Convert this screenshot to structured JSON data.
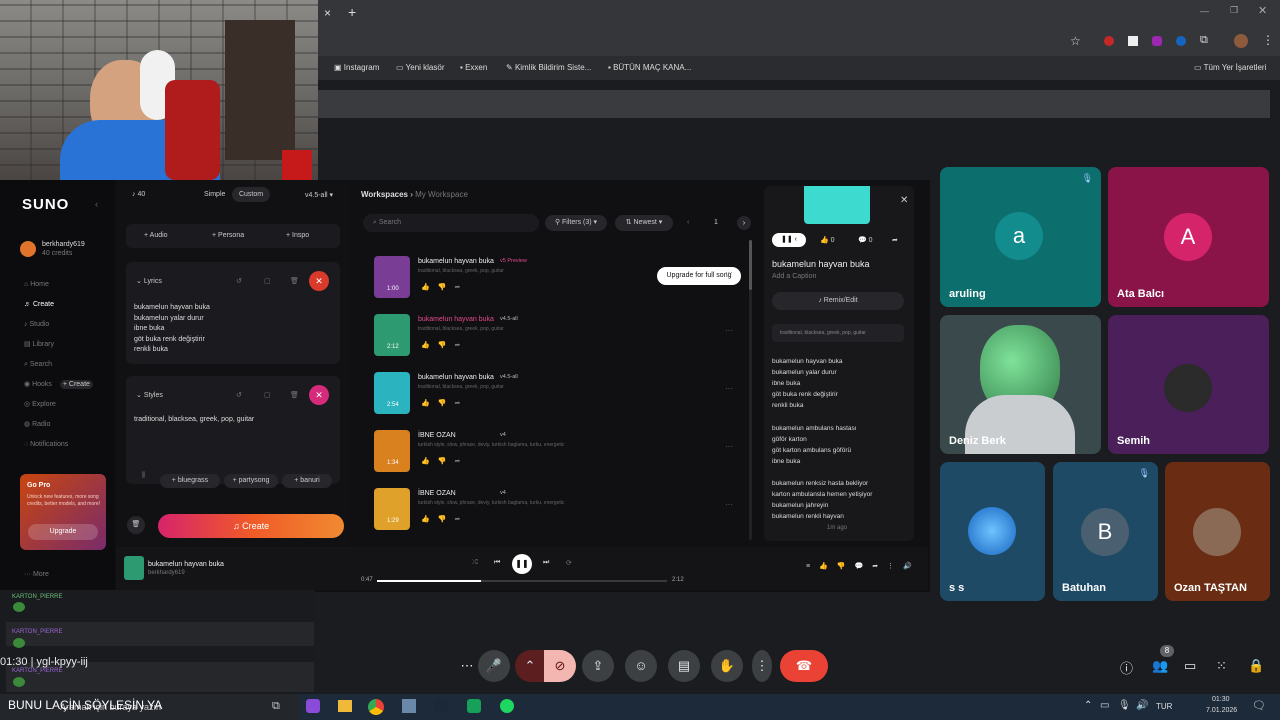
{
  "browser": {
    "new_tab": "+",
    "close": "×",
    "bookmarks": [
      "Instagram",
      "Yeni klasör",
      "Exxen",
      "Kimlik Bildirim Siste...",
      "BÜTÜN MAÇ KANA...",
      "Tüm Yer İşaretleri"
    ]
  },
  "suno": {
    "logo": "SUNO",
    "user": "berkhardy619",
    "credits": "40 credits",
    "nav": [
      "Home",
      "Create",
      "Studio",
      "Library",
      "Search",
      "Hooks",
      "Explore",
      "Radio",
      "Notifications"
    ],
    "hooks_create": "+ Create",
    "gopro": {
      "title": "Go Pro",
      "text": "Unlock new features, more song credits, better models, and more!",
      "button": "Upgrade"
    },
    "more": "More",
    "top": {
      "count": "40",
      "simple": "Simple",
      "custom": "Custom",
      "version": "v4.5-all"
    },
    "adds": [
      "+ Audio",
      "+ Persona",
      "+ Inspo"
    ],
    "lyrics_label": "Lyrics",
    "lyrics": [
      "bukamelun hayvan buka",
      "bukamelun yalar durur",
      "ibne buka",
      "göt buka renk değiştirir",
      "renkli buka"
    ],
    "styles_label": "Styles",
    "styles": "traditional, blacksea, greek, pop, guitar",
    "tags": [
      "+ bluegrass",
      "+ partysong",
      "+ banuri"
    ],
    "create": "Create",
    "breadcrumb": {
      "a": "Workspaces",
      "sep": "›",
      "b": "My Workspace"
    },
    "search_placeholder": "Search",
    "filters": "Filters (3)",
    "sort": "Newest",
    "page": "1",
    "upgrade_tip": "Upgrade for full song",
    "songs": [
      {
        "title": "bukamelun hayvan buka",
        "badge": "v5 Preview",
        "tags": "traditional, blacksea, greek, pop, guitar",
        "time": "1:00",
        "color": "#7a3d96"
      },
      {
        "title": "bukamelun hayvan buka",
        "badge": "v4.5-all",
        "tags": "traditional, blacksea, greek, pop, guitar",
        "time": "2:12",
        "color": "#2e9a72"
      },
      {
        "title": "bukamelun hayvan buka",
        "badge": "v4.5-all",
        "tags": "traditional, blacksea, greek, pop, guitar",
        "time": "2:54",
        "color": "#2bb3c0"
      },
      {
        "title": "İBNE OZAN",
        "badge": "v4",
        "tags": "turkish style, slow, phrase, deviy, turkish baglama, turku, energetic",
        "time": "1:34",
        "color": "#d9801f"
      },
      {
        "title": "İBNE OZAN",
        "badge": "v4",
        "tags": "turkish style, slow, phrase, deviy, turkish baglama, turku, energetic",
        "time": "1:29",
        "color": "#e0a12a"
      }
    ],
    "detail": {
      "likes": "0",
      "comments": "0",
      "title": "bukamelun hayvan buka",
      "caption": "Add a Caption",
      "remix": "Remix/Edit",
      "tags": "traditional, blacksea, greek, pop, guitar",
      "lyrics": [
        "bukamelun hayvan buka",
        "bukamelun yalar durur",
        "ibne buka",
        "göt buka renk değiştirir",
        "renkli buka",
        "",
        "bukamelun ambulans hastası",
        "göför karton",
        "göt karton ambulans göförü",
        "ibne buka",
        "",
        "bukamelun renksiz hasta bekliyor",
        "karton ambulansla hemen yetişiyor",
        "bukamelun jahreyin",
        "bukamelun renkli hayvan"
      ],
      "age": "1m ago"
    },
    "player": {
      "title": "bukamelun hayvan buka",
      "artist": "berkhardy619",
      "current": "0:47",
      "total": "2:12",
      "progress": 0.36
    }
  },
  "participants": [
    {
      "name": "aruling",
      "initial": "a",
      "bg": "#0d6e6e",
      "circle": "#128c8c",
      "muted": true
    },
    {
      "name": "Ata Balcı",
      "initial": "A",
      "bg": "#8a1448",
      "circle": "#d6246b",
      "muted": false
    },
    {
      "name": "Deniz Berk",
      "initial": "",
      "bg": "#3a4a4c",
      "circle": "",
      "muted": false
    },
    {
      "name": "Semih",
      "initial": "",
      "bg": "#4a1f5a",
      "circle": "",
      "muted": false
    },
    {
      "name": "s s",
      "initial": "",
      "bg": "#1e4a66",
      "circle": "",
      "muted": false
    },
    {
      "name": "Batuhan",
      "initial": "B",
      "bg": "#1e4a66",
      "circle": "#4a6070",
      "muted": true
    },
    {
      "name": "Ozan TAŞTAN",
      "initial": "",
      "bg": "#6a2c12",
      "circle": "",
      "muted": false
    }
  ],
  "chat": {
    "user1": "KARTON_PIERRE",
    "user2": "KARTON_PIERRE",
    "user3": "KARTON_PIERRE",
    "bottom": "BUNU LAÇİN SÖYLESİN YA"
  },
  "meeting": {
    "time": "01:30",
    "code": "ygl-kpyy-iij",
    "people": "8"
  },
  "taskbar": {
    "search": "Aramak için buraya yazın",
    "lang": "TUR",
    "time": "01:30",
    "date": "7.01.2026"
  }
}
